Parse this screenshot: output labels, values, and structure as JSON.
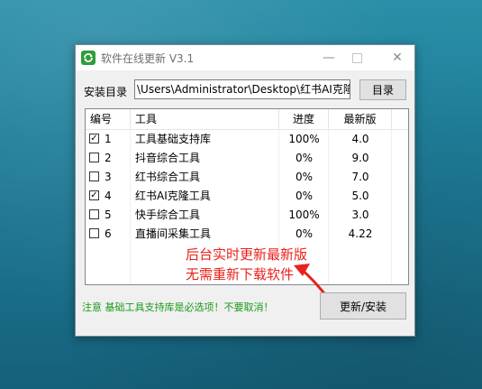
{
  "window": {
    "title": "软件在线更新 V3.1",
    "minimize_glyph": "—",
    "close_glyph": "✕"
  },
  "install": {
    "label": "安装目录",
    "path": "\\Users\\Administrator\\Desktop\\红书AI克隆",
    "browse_label": "目录"
  },
  "table": {
    "headers": [
      "编号",
      "工具",
      "进度",
      "最新版"
    ],
    "rows": [
      {
        "checked": true,
        "check_glyph": "✓",
        "num": "1",
        "name": "工具基础支持库",
        "progress": "100%",
        "version": "4.0"
      },
      {
        "checked": false,
        "check_glyph": "",
        "num": "2",
        "name": "抖音综合工具",
        "progress": "0%",
        "version": "9.0"
      },
      {
        "checked": false,
        "check_glyph": "",
        "num": "3",
        "name": "红书综合工具",
        "progress": "0%",
        "version": "7.0"
      },
      {
        "checked": true,
        "check_glyph": "✓",
        "num": "4",
        "name": "红书AI克隆工具",
        "progress": "0%",
        "version": "5.0"
      },
      {
        "checked": false,
        "check_glyph": "",
        "num": "5",
        "name": "快手综合工具",
        "progress": "100%",
        "version": "3.0"
      },
      {
        "checked": false,
        "check_glyph": "",
        "num": "6",
        "name": "直播间采集工具",
        "progress": "0%",
        "version": "4.22"
      }
    ]
  },
  "overlay": {
    "line1": "后台实时更新最新版",
    "line2": "无需重新下载软件",
    "color": "#e8221c"
  },
  "footer": {
    "notice": "注意 基础工具支持库是必选项！不要取消！",
    "update_label": "更新/安装"
  }
}
